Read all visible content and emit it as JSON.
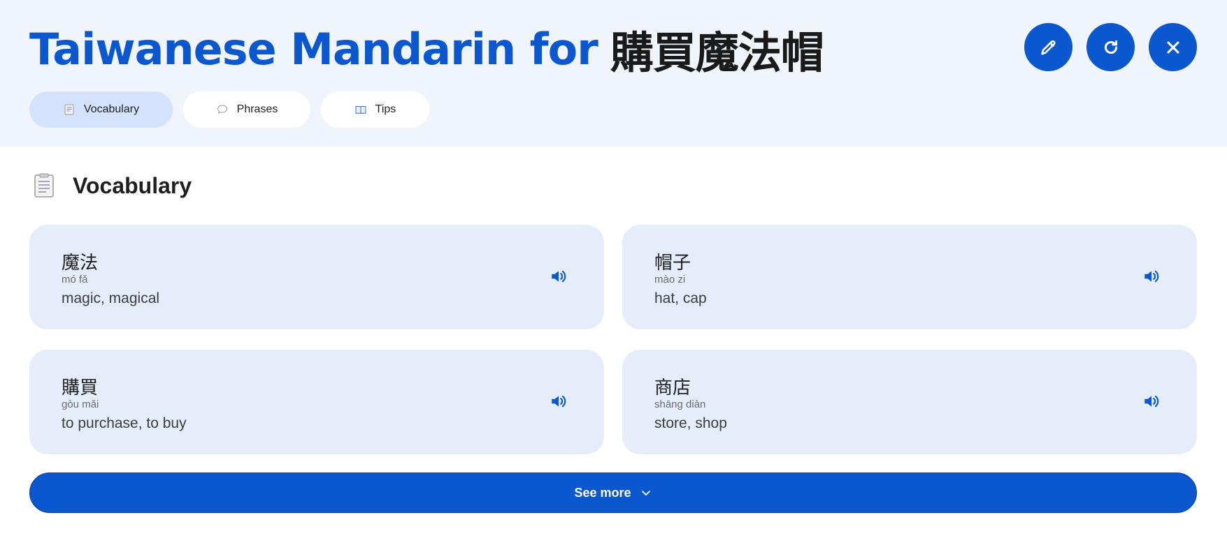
{
  "header": {
    "title_en": "Taiwanese Mandarin for",
    "title_zh": "購買魔法帽",
    "actions": [
      {
        "name": "edit",
        "icon": "pencil-icon"
      },
      {
        "name": "refresh",
        "icon": "refresh-icon"
      },
      {
        "name": "close",
        "icon": "close-icon"
      }
    ]
  },
  "tabs": [
    {
      "label": "Vocabulary",
      "icon": "notepad-icon",
      "active": true
    },
    {
      "label": "Phrases",
      "icon": "speech-bubble-icon",
      "active": false
    },
    {
      "label": "Tips",
      "icon": "open-book-icon",
      "active": false
    }
  ],
  "section": {
    "title": "Vocabulary",
    "icon": "notepad-icon"
  },
  "vocabulary": [
    {
      "word": "魔法",
      "pinyin": "mó fǎ",
      "meaning": "magic, magical"
    },
    {
      "word": "帽子",
      "pinyin": "mào zi",
      "meaning": "hat, cap"
    },
    {
      "word": "購買",
      "pinyin": "gòu mǎi",
      "meaning": "to purchase, to buy"
    },
    {
      "word": "商店",
      "pinyin": "shāng diàn",
      "meaning": "store, shop"
    }
  ],
  "see_more": {
    "label": "See more",
    "icon": "chevron-down-icon"
  },
  "colors": {
    "accent": "#0b57d0",
    "header_bg": "#f0f5fc",
    "card_bg": "#e5edfb",
    "active_tab_bg": "#d3e3fd"
  }
}
